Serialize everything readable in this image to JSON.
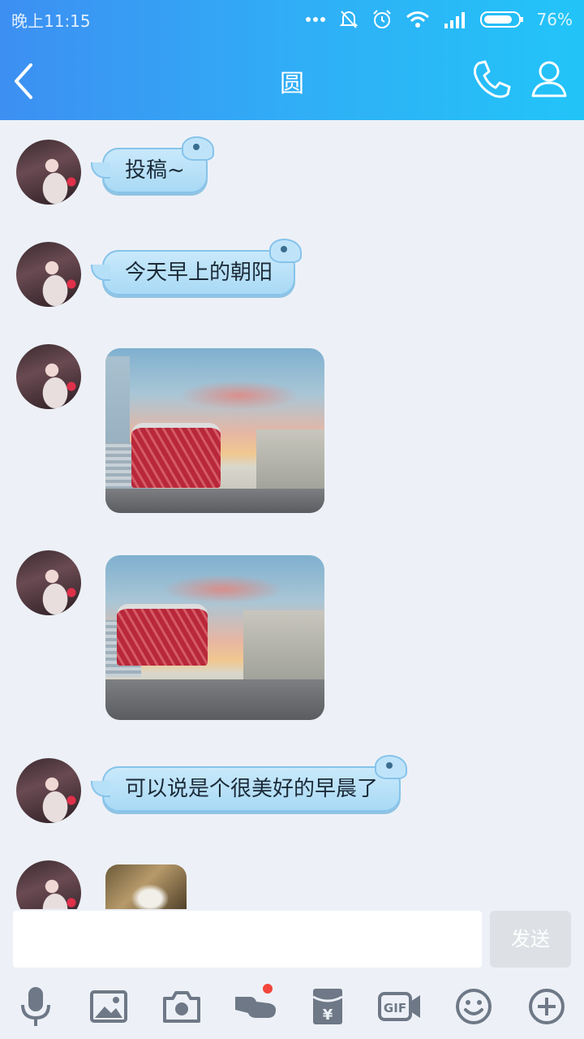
{
  "status_bar": {
    "time": "晚上11:15",
    "battery": "76%"
  },
  "nav": {
    "title": "圆"
  },
  "messages": [
    {
      "type": "text",
      "text": "投稿~"
    },
    {
      "type": "text",
      "text": "今天早上的朝阳"
    },
    {
      "type": "image"
    },
    {
      "type": "image"
    },
    {
      "type": "text",
      "text": "可以说是个很美好的早晨了"
    },
    {
      "type": "image"
    }
  ],
  "composer": {
    "input_value": "",
    "send_label": "发送"
  },
  "toolbar": {
    "icons": [
      "microphone-icon",
      "image-icon",
      "camera-icon",
      "poke-icon",
      "red-packet-icon",
      "gif-icon",
      "emoji-icon",
      "plus-icon"
    ],
    "gif_label": "GIF",
    "yuan_label": "¥"
  },
  "colors": {
    "header_start": "#3d8ff2",
    "header_end": "#22c4f8",
    "bubble": "#b6dff8",
    "notification_dot": "#f3453b"
  }
}
